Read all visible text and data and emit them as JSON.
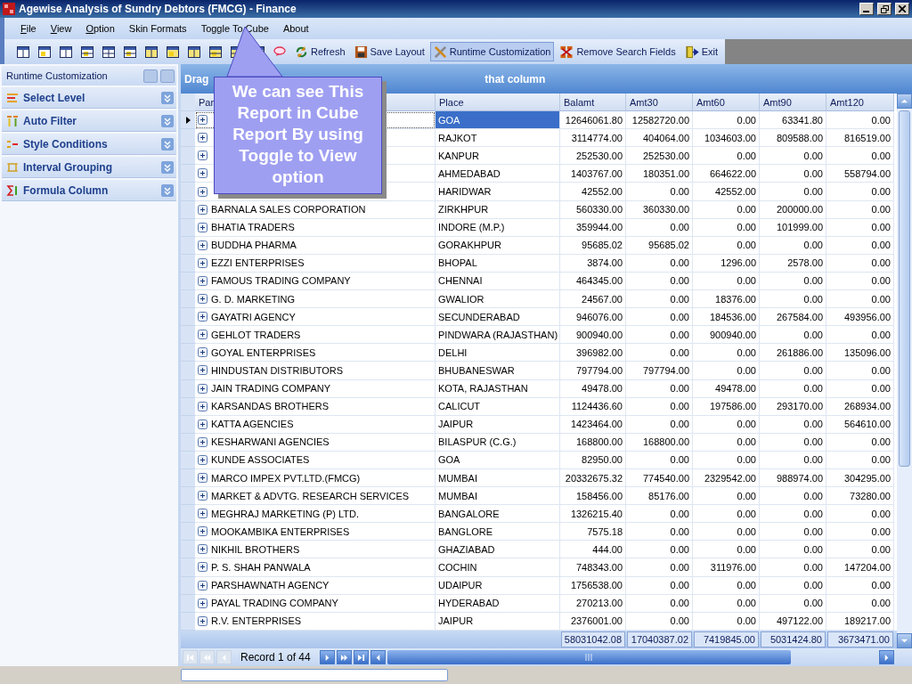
{
  "window": {
    "title": "Agewise Analysis of Sundry Debtors (FMCG) - Finance"
  },
  "menu": [
    {
      "label": "File",
      "underlined_initial": true
    },
    {
      "label": "View",
      "underlined_initial": true
    },
    {
      "label": "Option",
      "underlined_initial": true
    },
    {
      "label": "Skin Formats",
      "underlined_initial": false
    },
    {
      "label": "Toggle To Cube",
      "underlined_initial": false
    },
    {
      "label": "About",
      "underlined_initial": false
    }
  ],
  "toolbar": [
    {
      "label": "Refresh",
      "kind": "refresh",
      "selected": false
    },
    {
      "label": "Save Layout",
      "kind": "save",
      "selected": false
    },
    {
      "label": "Runtime Customization",
      "kind": "tools",
      "selected": true
    },
    {
      "label": "Remove Search Fields",
      "kind": "remove",
      "selected": false
    },
    {
      "label": "Exit",
      "kind": "exit",
      "selected": false
    }
  ],
  "side_panel": {
    "title": "Runtime Customization",
    "items": [
      {
        "label": "Select Level",
        "kind": "level"
      },
      {
        "label": "Auto Filter",
        "kind": "filter"
      },
      {
        "label": "Style Conditions",
        "kind": "style"
      },
      {
        "label": "Interval Grouping",
        "kind": "interval"
      },
      {
        "label": "Formula Column",
        "kind": "formula"
      }
    ]
  },
  "group_hint": [
    "Drag",
    "that column"
  ],
  "callout": "We can see This Report in Cube Report By using Toggle to View option",
  "table": {
    "columns": [
      "Par",
      "Place",
      "Balamt",
      "Amt30",
      "Amt60",
      "Amt90",
      "Amt120"
    ],
    "rows": [
      {
        "selected": true,
        "cells": [
          "",
          "GOA",
          "12646061.80",
          "12582720.00",
          "0.00",
          "63341.80",
          "0.00"
        ]
      },
      {
        "selected": false,
        "cells": [
          "",
          "RAJKOT",
          "3114774.00",
          "404064.00",
          "1034603.00",
          "809588.00",
          "816519.00"
        ]
      },
      {
        "selected": false,
        "cells": [
          "",
          "KANPUR",
          "252530.00",
          "252530.00",
          "0.00",
          "0.00",
          "0.00"
        ]
      },
      {
        "selected": false,
        "cells": [
          "",
          "AHMEDABAD",
          "1403767.00",
          "180351.00",
          "664622.00",
          "0.00",
          "558794.00"
        ]
      },
      {
        "selected": false,
        "cells": [
          "",
          "HARIDWAR",
          "42552.00",
          "0.00",
          "42552.00",
          "0.00",
          "0.00"
        ]
      },
      {
        "selected": false,
        "cells": [
          "BARNALA SALES CORPORATION",
          "ZIRKHPUR",
          "560330.00",
          "360330.00",
          "0.00",
          "200000.00",
          "0.00"
        ]
      },
      {
        "selected": false,
        "cells": [
          "BHATIA TRADERS",
          "INDORE (M.P.)",
          "359944.00",
          "0.00",
          "0.00",
          "101999.00",
          "0.00"
        ]
      },
      {
        "selected": false,
        "cells": [
          "BUDDHA PHARMA",
          "GORAKHPUR",
          "95685.02",
          "95685.02",
          "0.00",
          "0.00",
          "0.00"
        ]
      },
      {
        "selected": false,
        "cells": [
          "EZZI ENTERPRISES",
          "BHOPAL",
          "3874.00",
          "0.00",
          "1296.00",
          "2578.00",
          "0.00"
        ]
      },
      {
        "selected": false,
        "cells": [
          "FAMOUS TRADING COMPANY",
          "CHENNAI",
          "464345.00",
          "0.00",
          "0.00",
          "0.00",
          "0.00"
        ]
      },
      {
        "selected": false,
        "cells": [
          "G. D. MARKETING",
          "GWALIOR",
          "24567.00",
          "0.00",
          "18376.00",
          "0.00",
          "0.00"
        ]
      },
      {
        "selected": false,
        "cells": [
          "GAYATRI AGENCY",
          "SECUNDERABAD",
          "946076.00",
          "0.00",
          "184536.00",
          "267584.00",
          "493956.00"
        ]
      },
      {
        "selected": false,
        "cells": [
          "GEHLOT TRADERS",
          "PINDWARA (RAJASTHAN)",
          "900940.00",
          "0.00",
          "900940.00",
          "0.00",
          "0.00"
        ]
      },
      {
        "selected": false,
        "cells": [
          "GOYAL ENTERPRISES",
          "DELHI",
          "396982.00",
          "0.00",
          "0.00",
          "261886.00",
          "135096.00"
        ]
      },
      {
        "selected": false,
        "cells": [
          "HINDUSTAN DISTRIBUTORS",
          "BHUBANESWAR",
          "797794.00",
          "797794.00",
          "0.00",
          "0.00",
          "0.00"
        ]
      },
      {
        "selected": false,
        "cells": [
          "JAIN TRADING COMPANY",
          "KOTA, RAJASTHAN",
          "49478.00",
          "0.00",
          "49478.00",
          "0.00",
          "0.00"
        ]
      },
      {
        "selected": false,
        "cells": [
          "KARSANDAS BROTHERS",
          "CALICUT",
          "1124436.60",
          "0.00",
          "197586.00",
          "293170.00",
          "268934.00"
        ]
      },
      {
        "selected": false,
        "cells": [
          "KATTA AGENCIES",
          "JAIPUR",
          "1423464.00",
          "0.00",
          "0.00",
          "0.00",
          "564610.00"
        ]
      },
      {
        "selected": false,
        "cells": [
          "KESHARWANI AGENCIES",
          "BILASPUR (C.G.)",
          "168800.00",
          "168800.00",
          "0.00",
          "0.00",
          "0.00"
        ]
      },
      {
        "selected": false,
        "cells": [
          "KUNDE ASSOCIATES",
          "GOA",
          "82950.00",
          "0.00",
          "0.00",
          "0.00",
          "0.00"
        ]
      },
      {
        "selected": false,
        "cells": [
          "MARCO IMPEX PVT.LTD.(FMCG)",
          "MUMBAI",
          "20332675.32",
          "774540.00",
          "2329542.00",
          "988974.00",
          "304295.00"
        ]
      },
      {
        "selected": false,
        "cells": [
          "MARKET & ADVTG. RESEARCH SERVICES",
          "MUMBAI",
          "158456.00",
          "85176.00",
          "0.00",
          "0.00",
          "73280.00"
        ]
      },
      {
        "selected": false,
        "cells": [
          "MEGHRAJ MARKETING (P) LTD.",
          "BANGALORE",
          "1326215.40",
          "0.00",
          "0.00",
          "0.00",
          "0.00"
        ]
      },
      {
        "selected": false,
        "cells": [
          "MOOKAMBIKA ENTERPRISES",
          "BANGLORE",
          "7575.18",
          "0.00",
          "0.00",
          "0.00",
          "0.00"
        ]
      },
      {
        "selected": false,
        "cells": [
          "NIKHIL BROTHERS",
          "GHAZIABAD",
          "444.00",
          "0.00",
          "0.00",
          "0.00",
          "0.00"
        ]
      },
      {
        "selected": false,
        "cells": [
          "P. S. SHAH PANWALA",
          "COCHIN",
          "748343.00",
          "0.00",
          "311976.00",
          "0.00",
          "147204.00"
        ]
      },
      {
        "selected": false,
        "cells": [
          "PARSHAWNATH AGENCY",
          "UDAIPUR",
          "1756538.00",
          "0.00",
          "0.00",
          "0.00",
          "0.00"
        ]
      },
      {
        "selected": false,
        "cells": [
          "PAYAL TRADING COMPANY",
          "HYDERABAD",
          "270213.00",
          "0.00",
          "0.00",
          "0.00",
          "0.00"
        ]
      },
      {
        "selected": false,
        "cells": [
          "R.V. ENTERPRISES",
          "JAIPUR",
          "2376001.00",
          "0.00",
          "0.00",
          "497122.00",
          "189217.00"
        ]
      }
    ],
    "totals": [
      "58031042.08",
      "17040387.02",
      "7419845.00",
      "5031424.80",
      "3673471.00"
    ]
  },
  "navigator": {
    "record": "Record 1 of 44"
  }
}
